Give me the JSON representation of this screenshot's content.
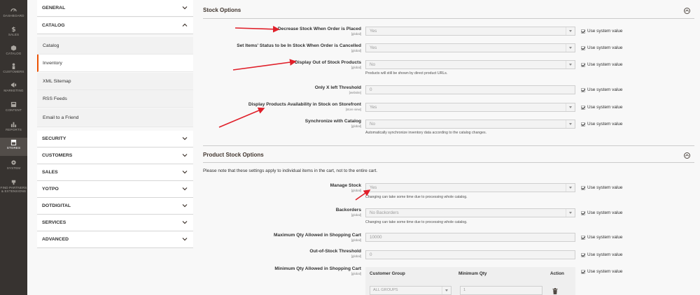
{
  "admin_nav": [
    {
      "label": "DASHBOARD",
      "icon": "dashboard-icon"
    },
    {
      "label": "SALES",
      "icon": "dollar-icon"
    },
    {
      "label": "CATALOG",
      "icon": "cube-icon"
    },
    {
      "label": "CUSTOMERS",
      "icon": "person-icon"
    },
    {
      "label": "MARKETING",
      "icon": "megaphone-icon"
    },
    {
      "label": "CONTENT",
      "icon": "content-icon"
    },
    {
      "label": "REPORTS",
      "icon": "bar-chart-icon"
    },
    {
      "label": "STORES",
      "icon": "store-icon"
    },
    {
      "label": "SYSTEM",
      "icon": "gear-icon"
    },
    {
      "label": "FIND PARTNERS & EXTENSIONS",
      "icon": "partners-icon"
    }
  ],
  "config_nav": {
    "general": "GENERAL",
    "catalog": "CATALOG",
    "catalog_items": [
      "Catalog",
      "Inventory",
      "XML Sitemap",
      "RSS Feeds",
      "Email to a Friend"
    ],
    "groups_after": [
      "SECURITY",
      "CUSTOMERS",
      "SALES",
      "YOTPO",
      "DOTDIGITAL",
      "SERVICES",
      "ADVANCED"
    ]
  },
  "stock_options": {
    "title": "Stock Options",
    "rows": [
      {
        "label": "Decrease Stock When Order is Placed",
        "scope": "[global]",
        "value": "Yes",
        "type": "select",
        "hint": "",
        "use_system": "Use system value"
      },
      {
        "label": "Set Items' Status to be In Stock When Order is Cancelled",
        "scope": "[global]",
        "value": "Yes",
        "type": "select",
        "hint": "",
        "use_system": "Use system value"
      },
      {
        "label": "Display Out of Stock Products",
        "scope": "[global]",
        "value": "No",
        "type": "select",
        "hint": "Products will still be shown by direct product URLs.",
        "use_system": "Use system value"
      },
      {
        "label": "Only X left Threshold",
        "scope": "[website]",
        "value": "0",
        "type": "text",
        "hint": "",
        "use_system": "Use system value"
      },
      {
        "label": "Display Products Availability in Stock on Storefront",
        "scope": "[store view]",
        "value": "Yes",
        "type": "select",
        "hint": "",
        "use_system": "Use system value"
      },
      {
        "label": "Synchronize with Catalog",
        "scope": "[global]",
        "value": "No",
        "type": "select",
        "hint": "Automatically synchronize inventory data according to the catalog changes.",
        "use_system": "Use system value"
      }
    ]
  },
  "product_stock_options": {
    "title": "Product Stock Options",
    "note": "Please note that these settings apply to individual items in the cart, not to the entire cart.",
    "rows": [
      {
        "label": "Manage Stock",
        "scope": "[global]",
        "value": "Yes",
        "type": "select",
        "hint": "Changing can take some time due to processing whole catalog.",
        "use_system": "Use system value"
      },
      {
        "label": "Backorders",
        "scope": "[global]",
        "value": "No Backorders",
        "type": "select",
        "hint": "Changing can take some time due to processing whole catalog.",
        "use_system": "Use system value"
      },
      {
        "label": "Maximum Qty Allowed in Shopping Cart",
        "scope": "[global]",
        "value": "10000",
        "type": "text",
        "hint": "",
        "use_system": "Use system value"
      },
      {
        "label": "Out-of-Stock Threshold",
        "scope": "[global]",
        "value": "0",
        "type": "text",
        "hint": "",
        "use_system": "Use system value"
      }
    ],
    "min_qty": {
      "label": "Minimum Qty Allowed in Shopping Cart",
      "scope": "[global]",
      "col_group": "Customer Group",
      "col_qty": "Minimum Qty",
      "col_action": "Action",
      "group_value": "ALL GROUPS",
      "qty_value": "1",
      "use_system": "Use system value"
    }
  },
  "colors": {
    "nav_bg": "#373330",
    "accent": "#eb5202",
    "annotation_arrow": "#e0202a"
  }
}
